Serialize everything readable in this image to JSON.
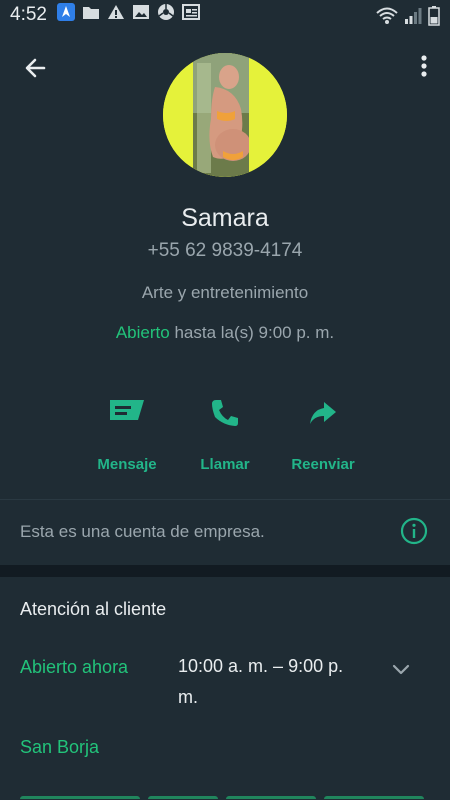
{
  "status_bar": {
    "time": "4:52",
    "left_icons": [
      "app-icon",
      "folder-icon",
      "warning-icon",
      "image-icon",
      "chrome-icon",
      "news-icon"
    ],
    "right_icons": [
      "wifi-icon",
      "signal-icon",
      "battery-icon"
    ]
  },
  "contact": {
    "name": "Samara",
    "phone": "+55 62 9839-4174",
    "category": "Arte y entretenimiento",
    "open_status": "Abierto",
    "hours_until": "hasta la(s) 9:00 p. m."
  },
  "actions": [
    {
      "label": "Mensaje",
      "icon": "message-icon"
    },
    {
      "label": "Llamar",
      "icon": "phone-icon"
    },
    {
      "label": "Reenviar",
      "icon": "forward-icon"
    }
  ],
  "business_notice": "Esta es una cuenta de empresa.",
  "customer_service": {
    "title": "Atención al cliente",
    "status": "Abierto ahora",
    "hours": "10:00 a. m. – 9:00 p. m.",
    "location": "San Borja"
  },
  "colors": {
    "accent": "#22b589",
    "background": "#1f2c34",
    "open_green": "#22c37a"
  }
}
